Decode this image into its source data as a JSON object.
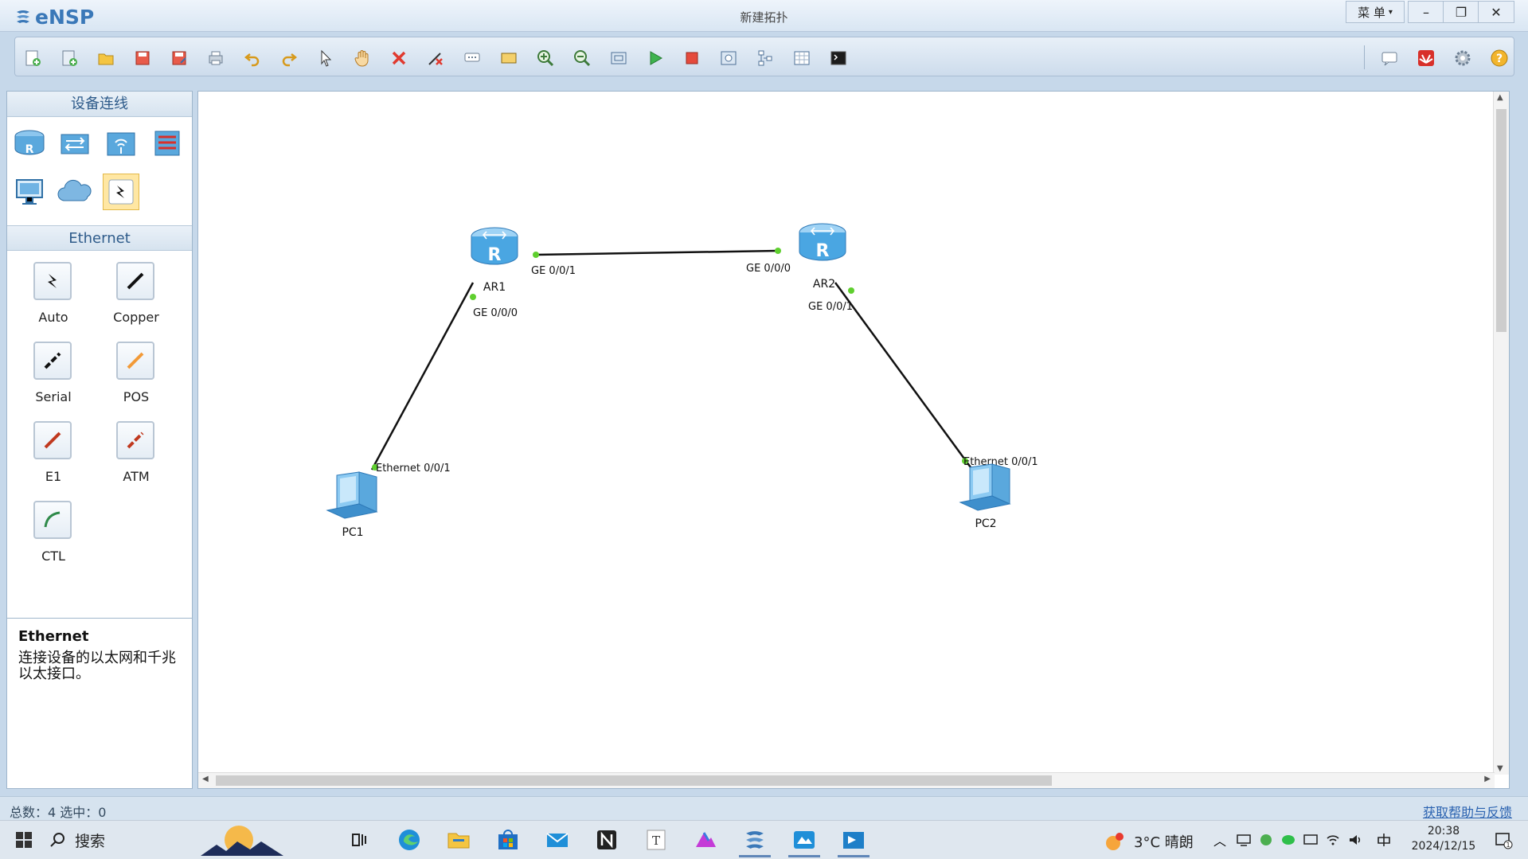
{
  "app": {
    "logo_text": "eNSP",
    "window_title": "新建拓扑",
    "menu_label": "菜 单",
    "controls": {
      "minimize": "–",
      "restore": "❐",
      "close": "✕"
    }
  },
  "toolbar": {
    "icons": [
      "new-topology-icon",
      "new-test-icon",
      "open-icon",
      "save-icon",
      "save-as-icon",
      "print-icon",
      "undo-icon",
      "redo-icon",
      "select-icon",
      "hand-icon",
      "delete-icon",
      "delete-link-icon",
      "text-icon",
      "rectangle-icon",
      "zoom-in-icon",
      "zoom-out-icon",
      "fit-icon",
      "start-icon",
      "stop-icon",
      "capture-icon",
      "topology-icon",
      "grid-icon",
      "terminal-icon"
    ],
    "right_icons": [
      "chat-icon",
      "huawei-icon",
      "settings-icon",
      "help-icon"
    ]
  },
  "left_panel": {
    "devices_title": "设备连线",
    "devices": [
      "router-icon",
      "switch-icon",
      "wlan-icon",
      "firewall-icon",
      "pc-icon",
      "cloud-icon",
      "auto-link-icon"
    ],
    "cables_title": "Ethernet",
    "cables": [
      {
        "label": "Auto",
        "color": "#222222"
      },
      {
        "label": "Copper",
        "color": "#111111"
      },
      {
        "label": "Serial",
        "color": "#111111"
      },
      {
        "label": "POS",
        "color": "#f29a38"
      },
      {
        "label": "E1",
        "color": "#c0391f"
      },
      {
        "label": "ATM",
        "color": "#c0391f"
      },
      {
        "label": "CTL",
        "color": "#2f8a4a"
      }
    ]
  },
  "description": {
    "title": "Ethernet",
    "text": "连接设备的以太网和千兆以太接口。"
  },
  "topology": {
    "nodes": [
      {
        "id": "AR1",
        "label": "AR1",
        "type": "router"
      },
      {
        "id": "AR2",
        "label": "AR2",
        "type": "router"
      },
      {
        "id": "PC1",
        "label": "PC1",
        "type": "pc"
      },
      {
        "id": "PC2",
        "label": "PC2",
        "type": "pc"
      }
    ],
    "links": [
      {
        "from": "AR1",
        "to": "AR2",
        "from_port": "GE 0/0/1",
        "to_port": "GE 0/0/0"
      },
      {
        "from": "AR1",
        "to": "PC1",
        "from_port": "GE 0/0/0",
        "to_port": "Ethernet 0/0/1"
      },
      {
        "from": "AR2",
        "to": "PC2",
        "from_port": "GE 0/0/1",
        "to_port": "Ethernet 0/0/1"
      }
    ]
  },
  "status": {
    "text": "总数：4 选中：0",
    "help": "获取帮助与反馈"
  },
  "taskbar": {
    "search": "搜索",
    "weather": "3°C 晴朗",
    "time": "20:38",
    "date": "2024/12/15"
  }
}
